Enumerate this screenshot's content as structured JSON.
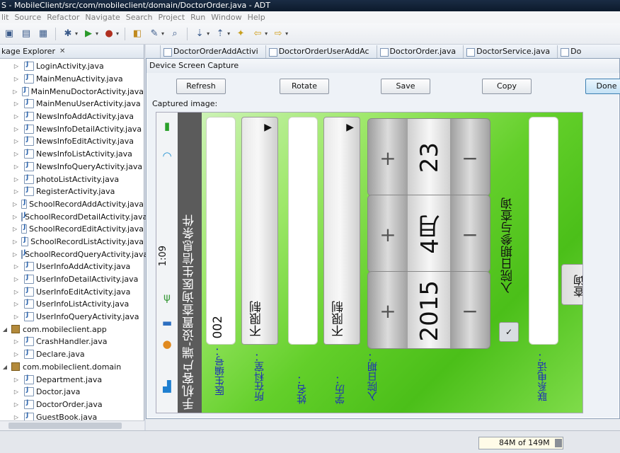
{
  "window": {
    "title": "S - MobileClient/src/com/mobileclient/domain/DoctorOrder.java - ADT"
  },
  "menu": {
    "items": [
      "lit",
      "Source",
      "Refactor",
      "Navigate",
      "Search",
      "Project",
      "Run",
      "Window",
      "Help"
    ]
  },
  "explorer": {
    "tab_label": "kage Explorer",
    "close_glyph": "✕",
    "rows": [
      {
        "type": "file",
        "label": "LoginActivity.java"
      },
      {
        "type": "file",
        "label": "MainMenuActivity.java"
      },
      {
        "type": "file",
        "label": "MainMenuDoctorActivity.java"
      },
      {
        "type": "file",
        "label": "MainMenuUserActivity.java"
      },
      {
        "type": "file",
        "label": "NewsInfoAddActivity.java"
      },
      {
        "type": "file",
        "label": "NewsInfoDetailActivity.java"
      },
      {
        "type": "file",
        "label": "NewsInfoEditActivity.java"
      },
      {
        "type": "file",
        "label": "NewsInfoListActivity.java"
      },
      {
        "type": "file",
        "label": "NewsInfoQueryActivity.java"
      },
      {
        "type": "file",
        "label": "photoListActivity.java"
      },
      {
        "type": "file",
        "label": "RegisterActivity.java"
      },
      {
        "type": "file",
        "label": "SchoolRecordAddActivity.java"
      },
      {
        "type": "file",
        "label": "SchoolRecordDetailActivity.java"
      },
      {
        "type": "file",
        "label": "SchoolRecordEditActivity.java"
      },
      {
        "type": "file",
        "label": "SchoolRecordListActivity.java"
      },
      {
        "type": "file",
        "label": "SchoolRecordQueryActivity.java"
      },
      {
        "type": "file",
        "label": "UserInfoAddActivity.java"
      },
      {
        "type": "file",
        "label": "UserInfoDetailActivity.java"
      },
      {
        "type": "file",
        "label": "UserInfoEditActivity.java"
      },
      {
        "type": "file",
        "label": "UserInfoListActivity.java"
      },
      {
        "type": "file",
        "label": "UserInfoQueryActivity.java"
      },
      {
        "type": "pkg",
        "label": "com.mobileclient.app"
      },
      {
        "type": "file",
        "label": "CrashHandler.java"
      },
      {
        "type": "file",
        "label": "Declare.java"
      },
      {
        "type": "pkg",
        "label": "com.mobileclient.domain"
      },
      {
        "type": "file",
        "label": "Department.java"
      },
      {
        "type": "file",
        "label": "Doctor.java"
      },
      {
        "type": "file",
        "label": "DoctorOrder.java"
      },
      {
        "type": "file",
        "label": "GuestBook.java"
      }
    ]
  },
  "editor_tabs": [
    "DoctorOrderAddActivi",
    "DoctorOrderUserAddAc",
    "DoctorOrder.java",
    "DoctorService.java",
    "Do"
  ],
  "dialog": {
    "title": "Device Screen Capture",
    "refresh": "Refresh",
    "rotate": "Rotate",
    "save": "Save",
    "copy": "Copy",
    "done": "Done",
    "captured_label": "Captured image:"
  },
  "phone": {
    "time": "1:09",
    "title": "手机客户端-设置查询医生信息条件",
    "labels": {
      "doctor_no": "医生编号：",
      "department": "所在科室：",
      "name": "姓名：",
      "education": "学历：",
      "admission_date": "入院日期：",
      "phone": "联系电话："
    },
    "doctor_no_value": "002",
    "department_value": "不限制",
    "education_value": "不限制",
    "date_picker": {
      "day": "23",
      "month": "4月",
      "year": "2015",
      "plus": "+",
      "minus": "−"
    },
    "date_checkbox_label": "入院日期参与查询",
    "query_button": "查询",
    "arrow_glyph": "▶",
    "check_glyph": "✓"
  },
  "status": {
    "heap": "84M of 149M"
  },
  "colors": {
    "phone_bg": "#63cf2a",
    "label_blue": "#1d2fb8",
    "primary_button": "#c3e1f5"
  }
}
